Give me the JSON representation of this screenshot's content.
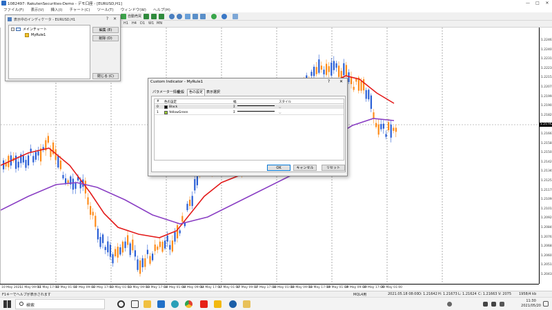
{
  "window": {
    "title": "1082497: RakutenSecurities-Demo - デモ口座 - [EURUSD,H1]",
    "controls": [
      "—",
      "□",
      "✕"
    ]
  },
  "menu": [
    "ファイル(F)",
    "表示(V)",
    "挿入(I)",
    "チャート(C)",
    "ツール(T)",
    "ウィンドウ(W)",
    "ヘルプ(H)"
  ],
  "toolbar": {
    "autotrade_label": "自動売買",
    "timeframes": [
      "H1",
      "H4",
      "D1",
      "W1",
      "MN"
    ]
  },
  "indicator_window": {
    "title": "表示中のインディケータ - EURUSD,H1",
    "help": "?",
    "close": "✕",
    "tree": {
      "root": "メインチャート",
      "child": "MyRule1"
    },
    "buttons": {
      "edit": "編集 (E)",
      "delete": "削除 (D)",
      "close": "閉じる (C)"
    }
  },
  "dialog": {
    "title": "Custom Indicator - MyRule1",
    "help": "?",
    "close": "✕",
    "tabs": [
      "パラメーター情報",
      "全般",
      "色の設定",
      "表示選択"
    ],
    "active_tab": "色の設定",
    "columns": [
      "#",
      "色の設定",
      "幅",
      "スタイル"
    ],
    "rows": [
      {
        "index": "0",
        "color_name": "Black",
        "swatch": "#000000"
      },
      {
        "index": "1",
        "color_name": "YellowGreen",
        "swatch": "#9acd32"
      }
    ],
    "buttons": {
      "ok": "OK",
      "cancel": "キャンセル",
      "reset": "リセット"
    }
  },
  "price_axis": [
    "1.22460",
    "1.22400",
    "1.22310",
    "1.22230",
    "1.22150",
    "1.22070",
    "1.21990",
    "1.21900",
    "1.21820",
    "1.21742",
    "1.21660",
    "1.21580",
    "1.21500",
    "1.21420",
    "1.21340",
    "1.21250",
    "1.21170",
    "1.21090",
    "1.21010",
    "1.20920",
    "1.20840",
    "1.20760",
    "1.20680",
    "1.20600",
    "1.20510",
    "1.20430"
  ],
  "current_price": "1.21742",
  "time_axis": [
    "10 May 2021",
    "11 May 09:00",
    "11 May 17:00",
    "12 May 01:00",
    "12 May 09:00",
    "12 May 17:00",
    "13 May 01:00",
    "13 May 09:00",
    "13 May 17:00",
    "14 May 01:00",
    "14 May 09:00",
    "14 May 17:00",
    "17 May 01:00",
    "17 May 09:00",
    "17 May 17:00",
    "18 May 01:00",
    "18 May 09:00",
    "18 May 17:00",
    "19 May 01:00",
    "19 May 09:00",
    "19 May 17:00",
    "20 May 01:00"
  ],
  "status": {
    "help": "F1キーでヘルプが表示されます",
    "profile": "MQL4用",
    "datetime": "2021.05.18 08:00",
    "open": "O: 1.21642",
    "high": "H: 1.21673",
    "low": "L: 1.21624",
    "close": "C: 1.21663",
    "volume": "V: 2075",
    "traffic": "1958/4 kb"
  },
  "taskbar": {
    "search_placeholder": "検索",
    "time": "11:30",
    "date": "2021/05/20"
  },
  "colors": {
    "bull": "#ff8c1a",
    "bear": "#2a5fd6",
    "ma_fast": "#e31b1b",
    "ma_slow": "#8a3fc4"
  }
}
